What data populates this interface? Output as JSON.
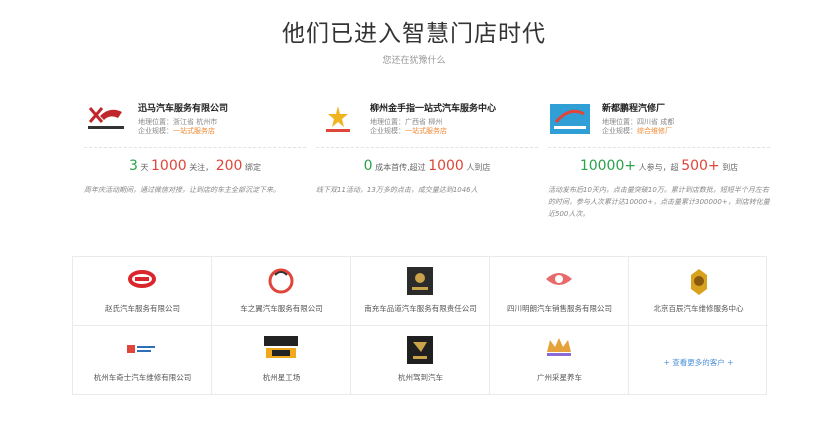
{
  "header": {
    "title": "他们已进入智慧门店时代",
    "subtitle": "您还在犹豫什么"
  },
  "cases": [
    {
      "name": "迅马汽车服务有限公司",
      "location_label": "地理位置：",
      "location": "浙江省 杭州市",
      "scale_label": "企业规模：",
      "scale": "一站式服务店",
      "stats": {
        "a": "3",
        "a_unit": "天",
        "b": "1000",
        "b_unit": "关注，",
        "c": "200",
        "c_unit": "绑定"
      },
      "desc": "周年庆活动期间，通过微信对接，让到店的车主全部沉淀下来。"
    },
    {
      "name": "柳州金手指一站式汽车服务中心",
      "location_label": "地理位置：",
      "location": "广西省 柳州",
      "scale_label": "企业规模：",
      "scale": "一站式服务店",
      "stats": {
        "a": "0",
        "a_unit": "成本首传,超过",
        "b": "1000",
        "b_unit": "人到店"
      },
      "desc": "线下双11活动，13万多的点击，成交量达到1046人"
    },
    {
      "name": "新都鹏程汽修厂",
      "location_label": "地理位置：",
      "location": "四川省 成都",
      "scale_label": "企业规模：",
      "scale": "综合维修厂",
      "stats": {
        "a": "10000+",
        "a_unit": "人参与，超",
        "b": "500+",
        "b_unit": "到店"
      },
      "desc": "活动发布后10天内，点击量突破10万。累计到店数批，短短半个月左右的时间，参与人次累计达10000+，点击量累计300000+，到店转化量近500人次。"
    }
  ],
  "partners": [
    {
      "label": "赵氏汽车服务有限公司",
      "icon": "auto-badge-logo"
    },
    {
      "label": "车之翼汽车服务有限公司",
      "icon": "ring-logo"
    },
    {
      "label": "南充车品道汽车服务有限责任公司",
      "icon": "dark-square-logo"
    },
    {
      "label": "四川明朗汽车销售服务有限公司",
      "icon": "red-emblem-logo"
    },
    {
      "label": "北京百辰汽车维修服务中心",
      "icon": "gold-lion-logo"
    },
    {
      "label": "杭州车奇士汽车维修有限公司",
      "icon": "small-text-logo"
    },
    {
      "label": "杭州星工场",
      "icon": "black-gold-logo"
    },
    {
      "label": "杭州驾到汽车",
      "icon": "dark-square-logo"
    },
    {
      "label": "广州采星养车",
      "icon": "crown-logo"
    }
  ],
  "more_link": "+ 查看更多的客户 +",
  "colors": {
    "green": "#2aa14a",
    "red": "#e0453a",
    "orange": "#f08a33",
    "link": "#4a8fd8"
  }
}
